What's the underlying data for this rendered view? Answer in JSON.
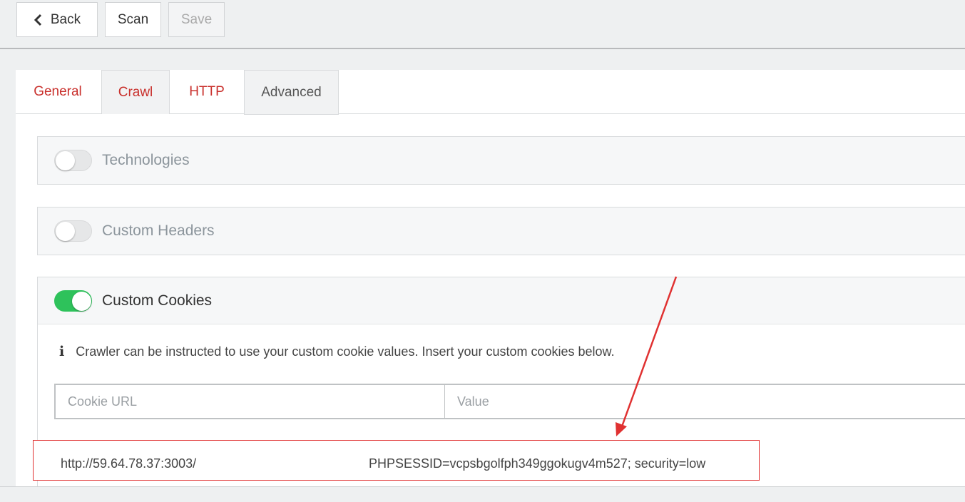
{
  "toolbar": {
    "back_label": "Back",
    "scan_label": "Scan",
    "save_label": "Save"
  },
  "tabs": [
    {
      "label": "General"
    },
    {
      "label": "Crawl"
    },
    {
      "label": "HTTP"
    },
    {
      "label": "Advanced"
    }
  ],
  "sections": {
    "technologies": {
      "title": "Technologies",
      "enabled": false
    },
    "custom_headers": {
      "title": "Custom Headers",
      "enabled": false
    },
    "custom_cookies": {
      "title": "Custom Cookies",
      "enabled": true,
      "info_text": "Crawler can be instructed to use your custom cookie values. Insert your custom cookies below.",
      "url_placeholder": "Cookie URL",
      "value_placeholder": "Value",
      "entry": {
        "url": "http://59.64.78.37:3003/",
        "value": "PHPSESSID=vcpsbgolfph349ggokugv4m527; security=low"
      }
    }
  },
  "colors": {
    "tab_accent": "#c9302c",
    "toggle_on": "#2ec25b",
    "annotation": "#e03131"
  }
}
